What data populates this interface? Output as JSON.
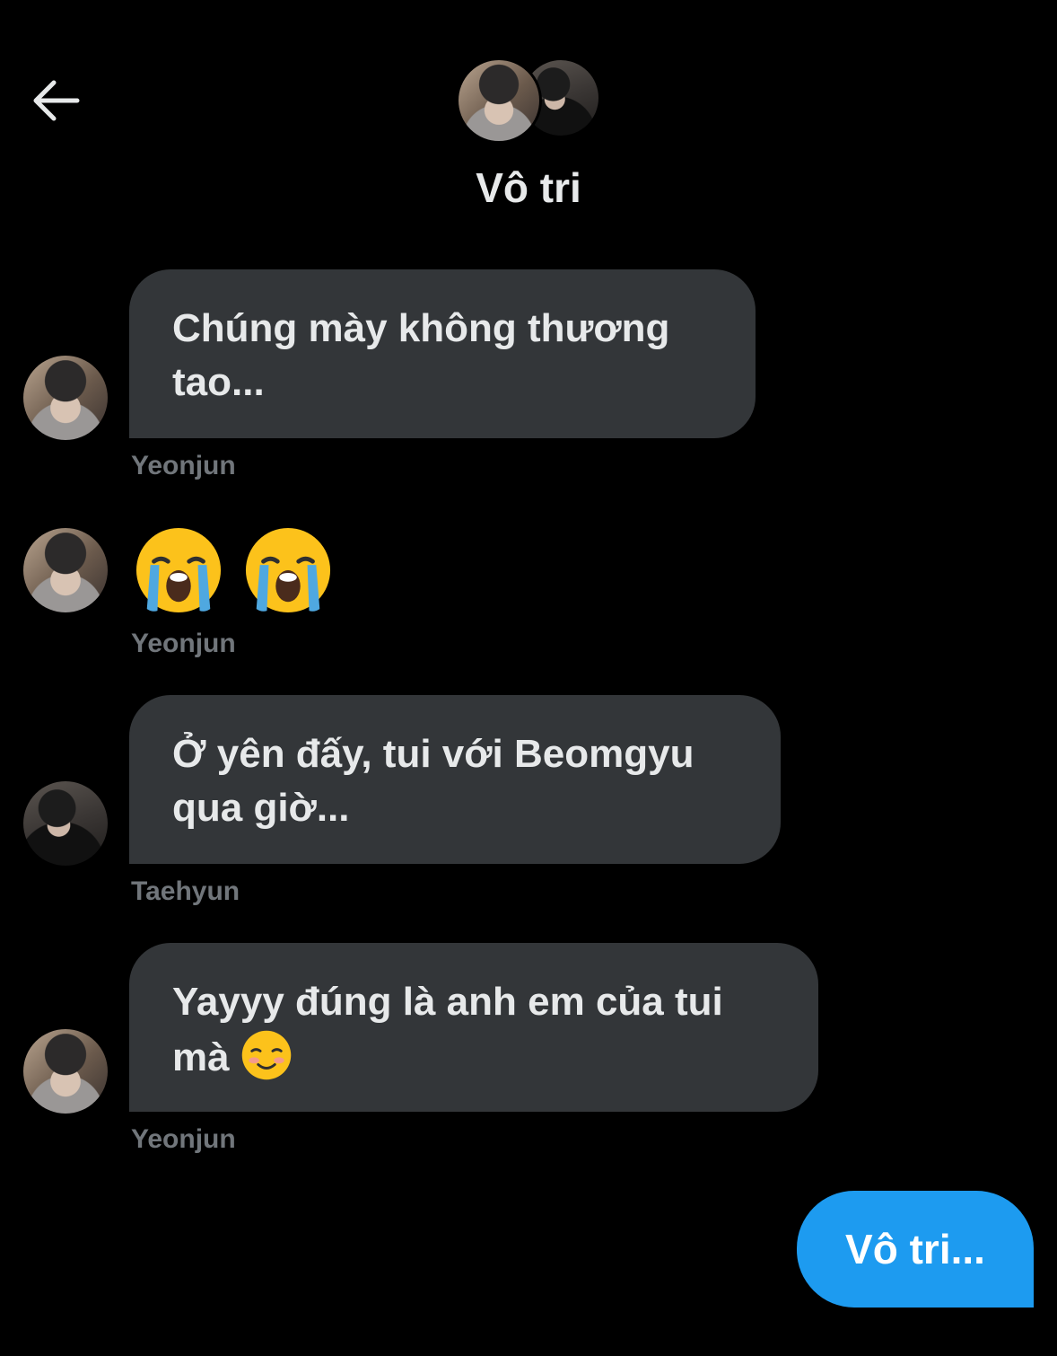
{
  "header": {
    "title": "Vô tri",
    "back_icon": "arrow-left-icon",
    "avatars": [
      "Yeonjun",
      "Taehyun"
    ]
  },
  "messages": [
    {
      "sender": "Yeonjun",
      "text_line1": "Chúng mày không thương",
      "text_line2": "tao..."
    },
    {
      "sender": "Yeonjun",
      "emojis": [
        "loudly-crying-face-icon",
        "loudly-crying-face-icon"
      ]
    },
    {
      "sender": "Taehyun",
      "text_line1": "Ở yên đấy, tui với Beomgyu",
      "text_line2": "qua giờ..."
    },
    {
      "sender": "Yeonjun",
      "text_line1": "Yayyy đúng là anh em của tui",
      "text_line2": "mà",
      "emoji": "smiling-face-icon"
    }
  ],
  "outgoing": {
    "text": "Vô tri..."
  },
  "colors": {
    "background": "#000000",
    "incoming_bubble": "#333639",
    "outgoing_bubble": "#1d9bf0",
    "sender_text": "#71767b",
    "message_text": "#e7e9ea"
  }
}
